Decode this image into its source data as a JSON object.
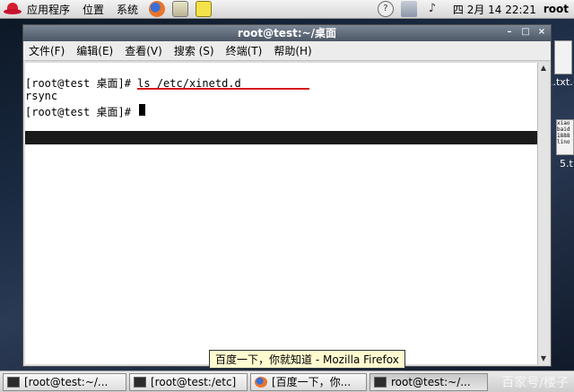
{
  "top_panel": {
    "menus": [
      "应用程序",
      "位置",
      "系统"
    ],
    "clock": "四 2月 14 22:21",
    "user": "root",
    "help_glyph": "?"
  },
  "desktop": {
    "file_labels": [
      "..txt.",
      "5.t"
    ],
    "file_thumb_text": "xiao\nbaid\n1888\nlino"
  },
  "window": {
    "title": "root@test:~/桌面",
    "controls": [
      "–",
      "□",
      "×"
    ],
    "menu": [
      "文件(F)",
      "编辑(E)",
      "查看(V)",
      "搜索 (S)",
      "终端(T)",
      "帮助(H)"
    ]
  },
  "terminal": {
    "lines": [
      "[root@test 桌面]# ls /etc/xinetd.d",
      "rsync",
      "[root@test 桌面]# "
    ]
  },
  "tooltip": "百度一下，你就知道 - Mozilla Firefox",
  "taskbar": {
    "items": [
      "[root@test:~/...",
      "[root@test:/etc]",
      "[百度一下，你...",
      "root@test:~/..."
    ],
    "watermark": "百家号/楼子"
  },
  "colors": {
    "annotation_underline": "#d61a1a",
    "terminal_bg": "#ffffff",
    "title_bar": "#4b5664"
  }
}
